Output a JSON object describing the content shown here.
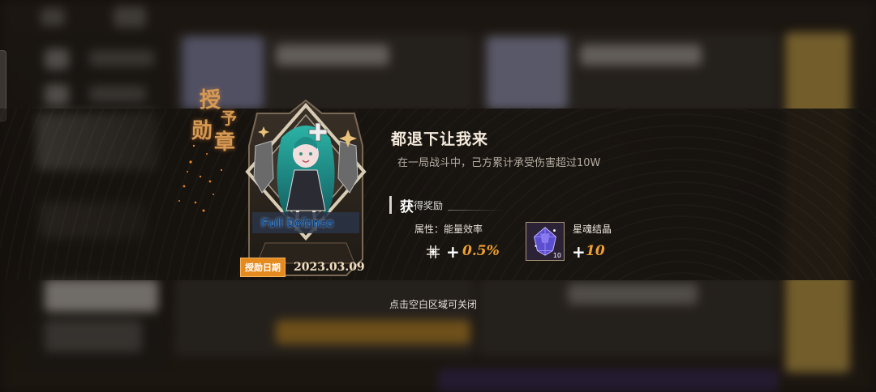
{
  "medal": {
    "award_title": [
      "授",
      "予",
      "勋",
      "章"
    ],
    "badge_text": "Full Defense",
    "date_label": "授勋日期",
    "date": "2023.03.09"
  },
  "achievement": {
    "title": "都退下让我来",
    "description": "在一局战斗中，己方累计承受伤害超过10W"
  },
  "rewards": {
    "heading_big": "获",
    "heading_small": "得奖励",
    "attribute": {
      "label": "属性：能量效率",
      "plus": "+",
      "value": "0.5%"
    },
    "item": {
      "name": "星魂结晶",
      "count": "10",
      "plus": "+",
      "value": "10"
    }
  },
  "hint": "点击空白区域可关闭",
  "colors": {
    "accent_orange": "#f0a030",
    "date_tag": "#e48a1e",
    "title_gold": "#d69a55",
    "badge_teal": "#1d8f8a"
  }
}
